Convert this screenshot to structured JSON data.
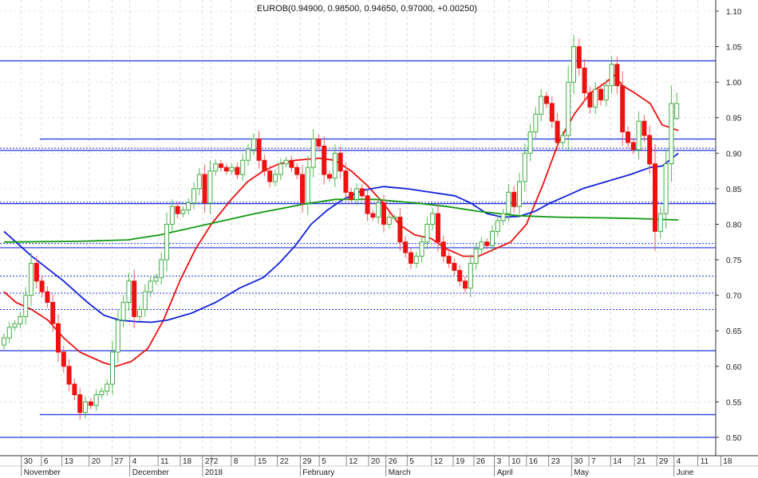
{
  "chart_data": {
    "type": "candlestick",
    "title": "EUROB(0.94900, 0.98500, 0.94650, 0.97000, +0.00250)",
    "last_ohlc": [
      0.949,
      0.985,
      0.9465,
      0.97
    ],
    "ylim": [
      0.5,
      1.1
    ],
    "yticks": [
      "0.50",
      "0.55",
      "0.60",
      "0.65",
      "0.70",
      "0.75",
      "0.80",
      "0.85",
      "0.90",
      "0.95",
      "1.00",
      "1.05",
      "1.10"
    ],
    "closes": [
      0.64,
      0.655,
      0.66,
      0.67,
      0.7,
      0.745,
      0.72,
      0.705,
      0.69,
      0.66,
      0.62,
      0.6,
      0.575,
      0.56,
      0.535,
      0.55,
      0.545,
      0.56,
      0.565,
      0.575,
      0.62,
      0.665,
      0.69,
      0.72,
      0.67,
      0.68,
      0.705,
      0.72,
      0.725,
      0.75,
      0.8,
      0.825,
      0.815,
      0.82,
      0.83,
      0.85,
      0.87,
      0.83,
      0.875,
      0.885,
      0.88,
      0.875,
      0.88,
      0.87,
      0.89,
      0.905,
      0.92,
      0.89,
      0.875,
      0.86,
      0.87,
      0.885,
      0.89,
      0.88,
      0.87,
      0.83,
      0.88,
      0.92,
      0.91,
      0.87,
      0.865,
      0.9,
      0.875,
      0.845,
      0.835,
      0.85,
      0.84,
      0.815,
      0.81,
      0.83,
      0.8,
      0.81,
      0.81,
      0.775,
      0.76,
      0.745,
      0.755,
      0.775,
      0.8,
      0.815,
      0.775,
      0.755,
      0.745,
      0.735,
      0.72,
      0.71,
      0.745,
      0.765,
      0.775,
      0.77,
      0.79,
      0.805,
      0.815,
      0.845,
      0.825,
      0.86,
      0.9,
      0.93,
      0.955,
      0.98,
      0.97,
      0.945,
      0.915,
      0.925,
      1.0,
      1.05,
      1.02,
      0.985,
      0.965,
      0.99,
      0.975,
      0.995,
      1.025,
      0.995,
      0.93,
      0.915,
      0.905,
      0.945,
      0.925,
      0.885,
      0.79,
      0.815,
      0.885,
      0.97,
      0.97
    ],
    "moving_averages": [
      {
        "name": "short",
        "color": "#ee1111",
        "points": [
          [
            0,
            0.705
          ],
          [
            2.2,
            0.69
          ],
          [
            5.1,
            0.68
          ],
          [
            8.1,
            0.665
          ],
          [
            11,
            0.64
          ],
          [
            14,
            0.62
          ],
          [
            18.4,
            0.605
          ],
          [
            20.6,
            0.6
          ],
          [
            23.5,
            0.607
          ],
          [
            26.5,
            0.625
          ],
          [
            29.4,
            0.665
          ],
          [
            32.4,
            0.72
          ],
          [
            35.3,
            0.765
          ],
          [
            38.2,
            0.8
          ],
          [
            41.9,
            0.835
          ],
          [
            44.9,
            0.86
          ],
          [
            47.8,
            0.875
          ],
          [
            50.7,
            0.885
          ],
          [
            53.7,
            0.89
          ],
          [
            58.1,
            0.893
          ],
          [
            61,
            0.89
          ],
          [
            64,
            0.875
          ],
          [
            66.9,
            0.855
          ],
          [
            69.9,
            0.83
          ],
          [
            72.8,
            0.8
          ],
          [
            75.7,
            0.785
          ],
          [
            78.7,
            0.78
          ],
          [
            81.6,
            0.765
          ],
          [
            84.6,
            0.755
          ],
          [
            87.5,
            0.755
          ],
          [
            90.4,
            0.765
          ],
          [
            93.4,
            0.775
          ],
          [
            96.3,
            0.8
          ],
          [
            99.3,
            0.855
          ],
          [
            102.2,
            0.915
          ],
          [
            105.1,
            0.955
          ],
          [
            108.1,
            0.985
          ],
          [
            111,
            1.0
          ],
          [
            112.5,
            1.01
          ],
          [
            114,
            0.995
          ],
          [
            116.2,
            0.985
          ],
          [
            119.1,
            0.97
          ],
          [
            121.3,
            0.94
          ],
          [
            124.3,
            0.932
          ]
        ]
      },
      {
        "name": "medium",
        "color": "#1122dd",
        "points": [
          [
            0,
            0.79
          ],
          [
            5.1,
            0.755
          ],
          [
            11,
            0.72
          ],
          [
            15.4,
            0.69
          ],
          [
            18.4,
            0.672
          ],
          [
            21.3,
            0.665
          ],
          [
            24.3,
            0.663
          ],
          [
            27.2,
            0.662
          ],
          [
            30.1,
            0.665
          ],
          [
            34.6,
            0.675
          ],
          [
            39,
            0.69
          ],
          [
            43.4,
            0.71
          ],
          [
            47.8,
            0.725
          ],
          [
            50.7,
            0.745
          ],
          [
            53.7,
            0.77
          ],
          [
            56.6,
            0.8
          ],
          [
            59.6,
            0.82
          ],
          [
            62.5,
            0.835
          ],
          [
            66.2,
            0.848
          ],
          [
            69.9,
            0.853
          ],
          [
            74.3,
            0.85
          ],
          [
            78.7,
            0.845
          ],
          [
            83.1,
            0.84
          ],
          [
            86,
            0.83
          ],
          [
            89,
            0.815
          ],
          [
            91.9,
            0.81
          ],
          [
            94.9,
            0.811
          ],
          [
            97.8,
            0.818
          ],
          [
            100.7,
            0.83
          ],
          [
            103.7,
            0.84
          ],
          [
            106.6,
            0.85
          ],
          [
            111,
            0.86
          ],
          [
            115.4,
            0.87
          ],
          [
            119.1,
            0.88
          ],
          [
            121.3,
            0.882
          ],
          [
            124.3,
            0.9
          ]
        ]
      },
      {
        "name": "long",
        "color": "#119911",
        "points": [
          [
            0,
            0.775
          ],
          [
            14,
            0.776
          ],
          [
            22.8,
            0.778
          ],
          [
            28.7,
            0.785
          ],
          [
            37.5,
            0.8
          ],
          [
            46.3,
            0.815
          ],
          [
            55.1,
            0.828
          ],
          [
            61,
            0.835
          ],
          [
            68.4,
            0.835
          ],
          [
            75.7,
            0.83
          ],
          [
            81.6,
            0.825
          ],
          [
            87.5,
            0.818
          ],
          [
            94.9,
            0.812
          ],
          [
            102.2,
            0.81
          ],
          [
            111,
            0.809
          ],
          [
            116.9,
            0.808
          ],
          [
            124.3,
            0.806
          ]
        ]
      }
    ],
    "horizontal_lines": [
      {
        "value": 1.03,
        "style": "solid"
      },
      {
        "value": 0.92,
        "style": "solid",
        "from": 6.6
      },
      {
        "value": 0.907,
        "style": "dotted"
      },
      {
        "value": 0.904,
        "style": "solid"
      },
      {
        "value": 0.831,
        "style": "dotted"
      },
      {
        "value": 0.829,
        "style": "solid"
      },
      {
        "value": 0.773,
        "style": "dotted"
      },
      {
        "value": 0.767,
        "style": "solid"
      },
      {
        "value": 0.727,
        "style": "dotted"
      },
      {
        "value": 0.703,
        "style": "dotted"
      },
      {
        "value": 0.68,
        "style": "dotted"
      },
      {
        "value": 0.622,
        "style": "solid"
      },
      {
        "value": 0.532,
        "style": "solid",
        "from": 6.6
      },
      {
        "value": 0.5,
        "style": "solid"
      }
    ],
    "xticks": [
      {
        "label": "30",
        "pos": 3.2
      },
      {
        "label": "6",
        "pos": 6.9
      },
      {
        "label": "13",
        "pos": 10.7
      },
      {
        "label": "20",
        "pos": 15.7
      },
      {
        "label": "27",
        "pos": 19.9
      },
      {
        "label": "4",
        "pos": 23.2
      },
      {
        "label": "11",
        "pos": 28.4
      },
      {
        "label": "18",
        "pos": 32.5
      },
      {
        "label": "27",
        "pos": 36.6
      },
      {
        "label": "2",
        "pos": 38.2
      },
      {
        "label": "8",
        "pos": 41.9
      },
      {
        "label": "15",
        "pos": 46.3
      },
      {
        "label": "22",
        "pos": 50.4
      },
      {
        "label": "29",
        "pos": 54.6
      },
      {
        "label": "5",
        "pos": 58.1
      },
      {
        "label": "12",
        "pos": 63.1
      },
      {
        "label": "20",
        "pos": 67.2
      },
      {
        "label": "26",
        "pos": 70.4
      },
      {
        "label": "5",
        "pos": 74.3
      },
      {
        "label": "12",
        "pos": 78.8
      },
      {
        "label": "19",
        "pos": 82.8
      },
      {
        "label": "26",
        "pos": 86.6
      },
      {
        "label": "3",
        "pos": 90.4
      },
      {
        "label": "10",
        "pos": 93.1
      },
      {
        "label": "16",
        "pos": 96.3
      },
      {
        "label": "23",
        "pos": 100.4
      },
      {
        "label": "30",
        "pos": 104.6
      },
      {
        "label": "7",
        "pos": 107.8
      },
      {
        "label": "14",
        "pos": 111.8
      },
      {
        "label": "21",
        "pos": 116.2
      },
      {
        "label": "29",
        "pos": 120.3
      },
      {
        "label": "4",
        "pos": 123.5
      },
      {
        "label": "11",
        "pos": 127.9
      },
      {
        "label": "18",
        "pos": 132.1
      }
    ],
    "months": [
      {
        "label": "November",
        "pos": 3.2
      },
      {
        "label": "December",
        "pos": 23.2
      },
      {
        "label": "2018",
        "pos": 36.6
      },
      {
        "label": "February",
        "pos": 54.6
      },
      {
        "label": "March",
        "pos": 70.4
      },
      {
        "label": "April",
        "pos": 90.4
      },
      {
        "label": "May",
        "pos": 104.6
      },
      {
        "label": "June",
        "pos": 123.5
      }
    ],
    "colors": {
      "up": "#44aa44",
      "down": "#ee1111",
      "hline": "#2233dd",
      "grid": "#c8c8c8"
    }
  }
}
